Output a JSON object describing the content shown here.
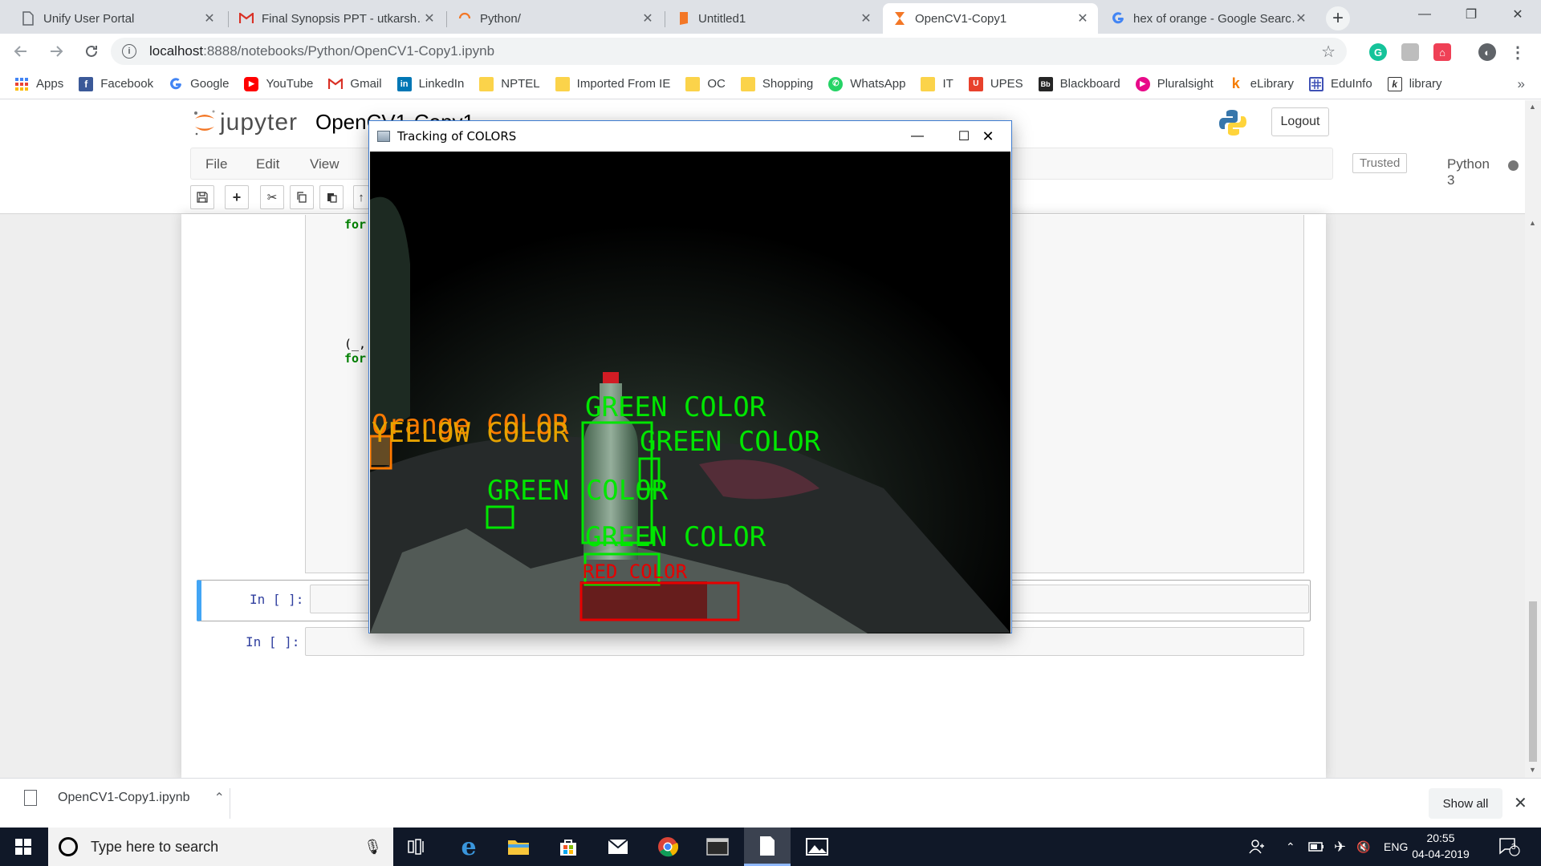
{
  "browser": {
    "tabs": [
      {
        "title": "Unify User Portal",
        "icon": "document-icon",
        "active": false
      },
      {
        "title": "Final Synopsis PPT - utkarsh…",
        "icon": "gmail-icon",
        "active": false
      },
      {
        "title": "Python/",
        "icon": "jupyter-spinner-icon",
        "active": false
      },
      {
        "title": "Untitled1",
        "icon": "notebook-icon",
        "active": false
      },
      {
        "title": "OpenCV1-Copy1",
        "icon": "hourglass-icon",
        "active": true
      },
      {
        "title": "hex of orange - Google Searc…",
        "icon": "google-icon",
        "active": false
      }
    ],
    "url_host": "localhost",
    "url_path": ":8888/notebooks/Python/OpenCV1-Copy1.ipynb",
    "bookmarks": [
      {
        "label": "Apps",
        "icon": "apps-grid-icon"
      },
      {
        "label": "Facebook",
        "icon": "facebook-icon"
      },
      {
        "label": "Google",
        "icon": "google-icon"
      },
      {
        "label": "YouTube",
        "icon": "youtube-icon"
      },
      {
        "label": "Gmail",
        "icon": "gmail-icon"
      },
      {
        "label": "LinkedIn",
        "icon": "linkedin-icon"
      },
      {
        "label": "NPTEL",
        "icon": "folder-icon"
      },
      {
        "label": "Imported From IE",
        "icon": "folder-icon"
      },
      {
        "label": "OC",
        "icon": "folder-icon"
      },
      {
        "label": "Shopping",
        "icon": "folder-icon"
      },
      {
        "label": "WhatsApp",
        "icon": "whatsapp-icon"
      },
      {
        "label": "IT",
        "icon": "folder-icon"
      },
      {
        "label": "UPES",
        "icon": "upes-icon"
      },
      {
        "label": "Blackboard",
        "icon": "blackboard-icon"
      },
      {
        "label": "Pluralsight",
        "icon": "pluralsight-icon"
      },
      {
        "label": "eLibrary",
        "icon": "elibrary-icon"
      },
      {
        "label": "EduInfo",
        "icon": "eduinfo-icon"
      },
      {
        "label": "library",
        "icon": "library-icon"
      }
    ],
    "bookmarks_more": "»"
  },
  "jupyter": {
    "logo_text": "jupyter",
    "notebook_name": "OpenCV1-Copy1",
    "logout_label": "Logout",
    "menu": [
      "File",
      "Edit",
      "View"
    ],
    "trusted_label": "Trusted",
    "kernel_label": "Python 3",
    "code_fragments": [
      "for",
      "(_,",
      "for",
      ")"
    ],
    "cells": [
      {
        "prompt": "In [ ]:",
        "selected": true
      },
      {
        "prompt": "In [ ]:",
        "selected": false
      }
    ]
  },
  "opencv_window": {
    "title": "Tracking of COLORS",
    "labels": [
      {
        "text": "Orange COLOR",
        "color": "#ff7a00"
      },
      {
        "text": "YELLOW COLOR",
        "color": "#e6a200"
      },
      {
        "text": "GREEN COLOR",
        "color": "#00e600"
      },
      {
        "text": "GREEN COLOR",
        "color": "#00e600"
      },
      {
        "text": "GREEN COLOR",
        "color": "#00e600"
      },
      {
        "text": "GREEN COLOR",
        "color": "#00e600"
      },
      {
        "text": "RED COLOR",
        "color": "#e60000"
      }
    ]
  },
  "download_shelf": {
    "file_name": "OpenCV1-Copy1.ipynb",
    "show_all_label": "Show all"
  },
  "taskbar": {
    "search_placeholder": "Type here to search",
    "language": "ENG",
    "time": "20:55",
    "date": "04-04-2019",
    "notifications_count": "3"
  },
  "colors": {
    "chrome_tabstrip": "#dee1e6",
    "jupyter_selected_border": "#42a5f5",
    "prompt_blue": "#303f9f",
    "taskbar": "#101828"
  }
}
